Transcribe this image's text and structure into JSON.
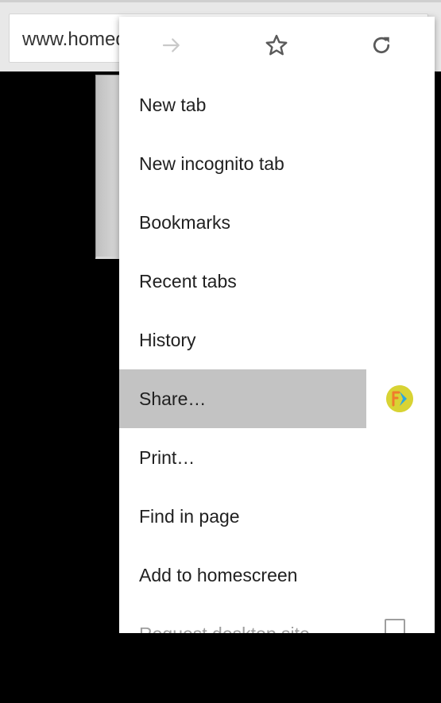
{
  "toolbar": {
    "url": "www.homed"
  },
  "menu": {
    "icons": [
      "forward-icon",
      "star-icon",
      "reload-icon"
    ],
    "items": [
      {
        "label": "New tab"
      },
      {
        "label": "New incognito tab"
      },
      {
        "label": "Bookmarks"
      },
      {
        "label": "Recent tabs"
      },
      {
        "label": "History"
      },
      {
        "label": "Share…"
      },
      {
        "label": "Print…"
      },
      {
        "label": "Find in page"
      },
      {
        "label": "Add to homescreen"
      },
      {
        "label": "Request desktop site"
      }
    ],
    "highlighted_item": "Share…",
    "share_app_icon": "app-logo-icon"
  },
  "colors": {
    "menu_background": "#ffffff",
    "highlight": "#c3c3c3",
    "page_background": "#000000"
  }
}
